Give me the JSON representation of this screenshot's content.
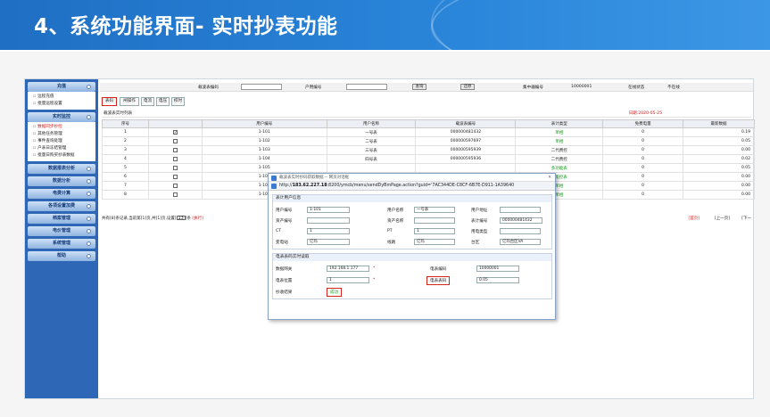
{
  "slide_title": "4、系统功能界面- 实时抄表功能",
  "sidebar": {
    "sections": [
      {
        "label": "充值",
        "items": [
          "远程充值",
          "批量远程设置"
        ]
      },
      {
        "label": "实时监控",
        "items": [
          "数据同步抄控",
          "其他任务管理",
          "事件查询处理",
          "户表日冻结管理",
          "批量日购买抄表数据"
        ]
      },
      {
        "label": "数据报表分析",
        "items": []
      },
      {
        "label": "数据分析",
        "items": []
      },
      {
        "label": "电费计算",
        "items": []
      },
      {
        "label": "各项设置加费",
        "items": []
      },
      {
        "label": "档案管理",
        "items": []
      },
      {
        "label": "电价管理",
        "items": []
      },
      {
        "label": "系统管理",
        "items": []
      },
      {
        "label": "帮助",
        "items": []
      }
    ]
  },
  "topbar": {
    "meter_no_label": "载波表编码",
    "user_no_label": "户用编号",
    "query_btn": "查询",
    "reset_btn": "还原",
    "concentrator_label": "集中器编号",
    "concentrator_value": "10000001",
    "online_label": "在线状态",
    "online_value": "不在线"
  },
  "tabs": [
    "表码",
    "闸操作",
    "电流",
    "电压",
    "校时"
  ],
  "grid": {
    "title": "载波表实时列表",
    "date": "日期:2020-05-25",
    "headers": [
      "序号",
      "",
      "用户编号",
      "用户名称",
      "载波表编号",
      "表计类型",
      "免费电量",
      "最新数据"
    ],
    "rows": [
      {
        "no": "1",
        "checked": true,
        "user": "1-101",
        "name": "一号表",
        "meter": "000000481432",
        "type": "单相",
        "free": "0",
        "latest": "0.19"
      },
      {
        "no": "2",
        "checked": false,
        "user": "1-102",
        "name": "二号表",
        "meter": "000000597697",
        "type": "单相",
        "free": "0",
        "latest": "0.05"
      },
      {
        "no": "3",
        "checked": false,
        "user": "1-103",
        "name": "三号表",
        "meter": "000000595939",
        "type": "二代费控",
        "free": "0",
        "latest": "0.00"
      },
      {
        "no": "4",
        "checked": false,
        "user": "1-104",
        "name": "四号表",
        "meter": "000000595936",
        "type": "二代费控",
        "free": "0",
        "latest": "0.02"
      },
      {
        "no": "5",
        "checked": false,
        "user": "1-105",
        "name": "",
        "meter": "",
        "type": "多功能表",
        "free": "0",
        "latest": "0.05"
      },
      {
        "no": "6",
        "checked": false,
        "user": "1-106",
        "name": "",
        "meter": "",
        "type": "智能控表",
        "free": "0",
        "latest": "0.00"
      },
      {
        "no": "7",
        "checked": false,
        "user": "1-107",
        "name": "",
        "meter": "",
        "type": "单相",
        "free": "0",
        "latest": "0.00"
      },
      {
        "no": "8",
        "checked": false,
        "user": "1-108",
        "name": "",
        "meter": "",
        "type": "单相",
        "free": "0",
        "latest": "0.00"
      }
    ],
    "footer": "共有[8]条记录,当前第[1]页,共[1]页,设置[",
    "page_size": "13",
    "footer_tail": "]条",
    "footer_exec": "[执行]",
    "first_page": "[首页]",
    "prev_page": "[上一页]",
    "next_page": "[下一"
  },
  "dialog": {
    "title": "载波表实时抄码获取数据 -- 网页对话框",
    "url_prefix": "http://",
    "url_host": "183.62.227.18",
    "url_rest": ":8200/ymcb/menu/sendDyBmPage.action?guid='7AC344DE-C8CF-6B7E-D911-1A39640",
    "section1_title": "表计用户信息",
    "user_no_label": "用户编号",
    "user_no": "1-101",
    "user_name_label": "用户名称",
    "user_name": "一号表",
    "user_addr_label": "用户地址",
    "user_addr": "",
    "asset_no_label": "资产编号",
    "asset_no": "",
    "asset_name_label": "资产名称",
    "asset_name": "",
    "meter_no_label": "表计编号",
    "meter_no": "000000481432",
    "ct_label": "CT",
    "ct": "1",
    "pt_label": "PT",
    "pt": "1",
    "user_type_label": "用电类型",
    "user_type": "",
    "station_label": "变电站",
    "station": "亿玛",
    "line_label": "线路",
    "line": "亿玛",
    "area_label": "台区",
    "area": "亿玛台区VA",
    "section2_title": "电表表码实时读取",
    "ip_label": "数据网关",
    "ip": "192.168.1.177",
    "code_label": "电表编码",
    "code": "10000001",
    "pos_label": "电表位置",
    "pos": "1",
    "reading_label": "电表表码",
    "reading": "0.05",
    "result_label": "抄收结果",
    "result": "成功"
  }
}
